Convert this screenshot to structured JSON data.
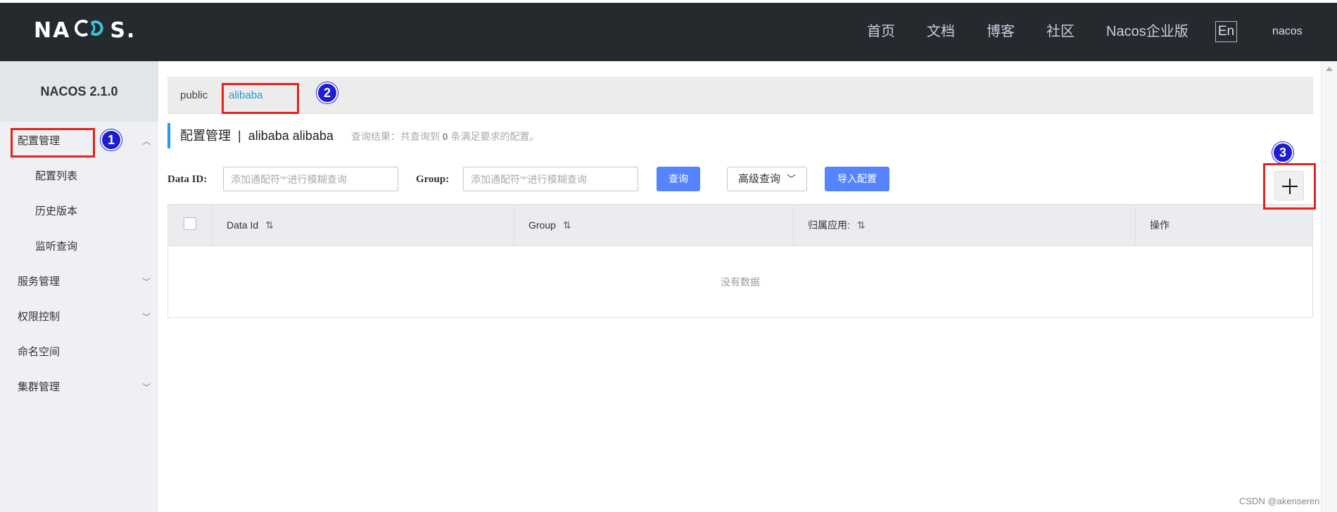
{
  "header": {
    "logo_text_left": "NA",
    "logo_text_right": "S.",
    "nav": [
      "首页",
      "文档",
      "博客",
      "社区",
      "Nacos企业版"
    ],
    "lang_button": "En",
    "user": "nacos"
  },
  "sidebar": {
    "version": "NACOS 2.1.0",
    "items": [
      {
        "label": "配置管理"
      },
      {
        "label": "配置列表"
      },
      {
        "label": "历史版本"
      },
      {
        "label": "监听查询"
      },
      {
        "label": "服务管理"
      },
      {
        "label": "权限控制"
      },
      {
        "label": "命名空间"
      },
      {
        "label": "集群管理"
      }
    ]
  },
  "namespaces": {
    "tabs": [
      "public",
      "alibaba"
    ],
    "active": "alibaba"
  },
  "page": {
    "title": "配置管理",
    "separator": "|",
    "namespace_name": "alibaba",
    "namespace_id": "alibaba",
    "result_prefix": "查询结果：共查询到",
    "result_count": "0",
    "result_suffix": "条满足要求的配置。"
  },
  "search": {
    "dataid_label": "Data ID:",
    "dataid_placeholder": "添加通配符'*'进行模糊查询",
    "group_label": "Group:",
    "group_placeholder": "添加通配符'*'进行模糊查询",
    "query_button": "查询",
    "advanced_button": "高级查询",
    "import_button": "导入配置"
  },
  "table": {
    "columns": [
      "Data Id",
      "Group",
      "归属应用:",
      "操作"
    ],
    "empty_text": "没有数据"
  },
  "annotations": [
    "1",
    "2",
    "3"
  ],
  "watermark": "CSDN @akenseren",
  "colors": {
    "header_bg": "#252a2f",
    "primary_button": "#5584ff",
    "active_tab": "#1d9ed6",
    "annotation_box": "#e5231c",
    "annotation_badge": "#1d1ecf"
  }
}
